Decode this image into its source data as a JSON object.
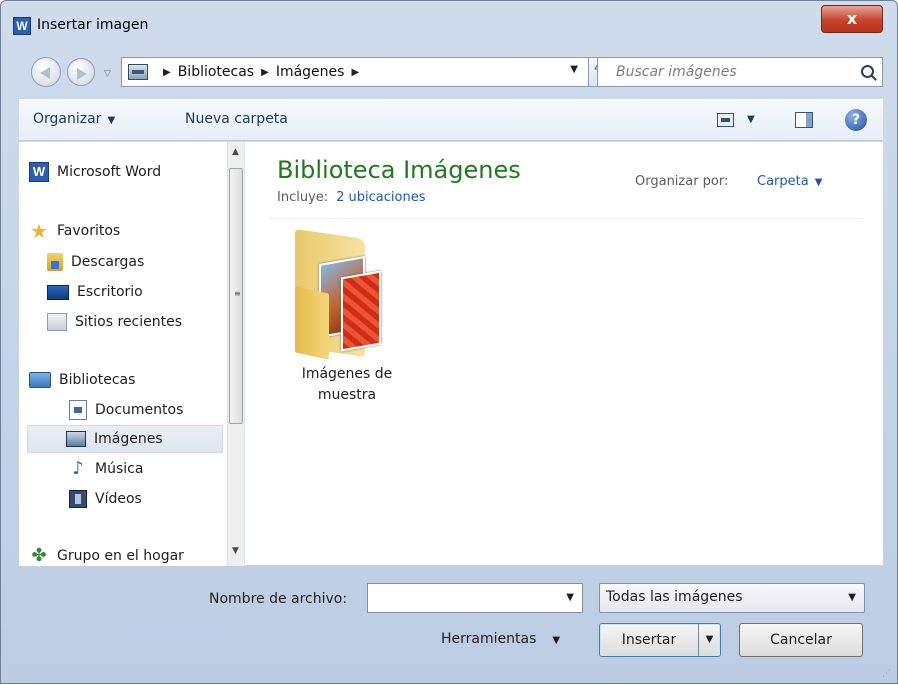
{
  "window": {
    "title": "Insertar imagen",
    "app_icon": "W",
    "close": "x"
  },
  "address_bar": {
    "crumbs": [
      "Bibliotecas",
      "Imágenes"
    ],
    "search_placeholder": "Buscar imágenes"
  },
  "toolbar": {
    "organize": "Organizar",
    "new_folder": "Nueva carpeta"
  },
  "sidebar": {
    "word": "Microsoft Word",
    "favorites": "Favoritos",
    "downloads": "Descargas",
    "desktop": "Escritorio",
    "recent": "Sitios recientes",
    "libraries": "Bibliotecas",
    "documents": "Documentos",
    "images": "Imágenes",
    "music": "Música",
    "videos": "Vídeos",
    "homegroup": "Grupo en el hogar"
  },
  "main": {
    "title": "Biblioteca Imágenes",
    "includes_label": "Incluye:",
    "includes_link": "2 ubicaciones",
    "arrange_label": "Organizar por:",
    "arrange_value": "Carpeta",
    "items": [
      {
        "label_line1": "Imágenes de",
        "label_line2": "muestra"
      }
    ]
  },
  "bottom": {
    "filename_label": "Nombre de archivo:",
    "filename_value": "",
    "filter": "Todas las imágenes",
    "tools": "Herramientas",
    "insert": "Insertar",
    "cancel": "Cancelar"
  },
  "icons": {
    "close": "close-icon",
    "search": "search-icon",
    "help": "help-icon"
  }
}
